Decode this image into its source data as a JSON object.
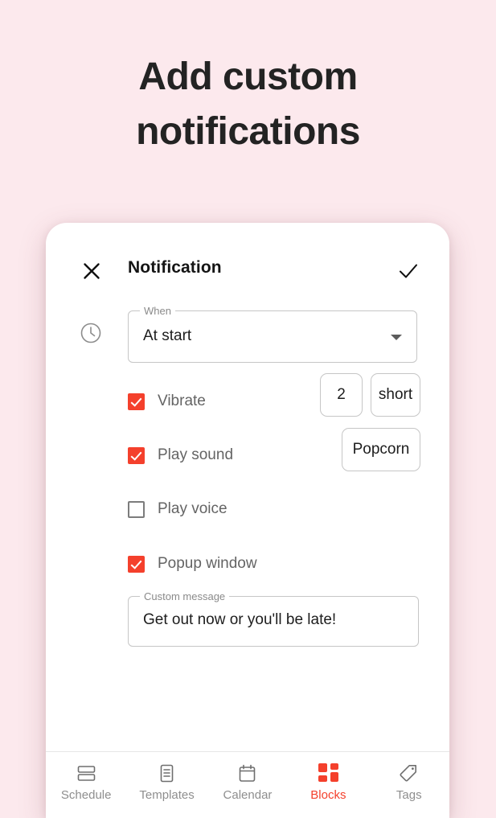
{
  "headline": {
    "line1": "Add custom",
    "line2": "notifications"
  },
  "colors": {
    "background": "#fce9ed",
    "accent": "#f4402c",
    "card": "#ffffff",
    "text_primary": "#1d1d1d",
    "text_secondary": "#646464",
    "border": "#c6c6c6"
  },
  "appbar": {
    "close_icon": "close-x-icon",
    "title": "Notification",
    "done_icon": "checkmark-icon"
  },
  "form": {
    "leading_icon": "clock-icon",
    "when": {
      "label": "When",
      "value": "At start",
      "caret_icon": "chevron-down-icon"
    },
    "options": [
      {
        "name": "vibrate",
        "label": "Vibrate",
        "checked": true,
        "chips": [
          {
            "name": "vibrate-count",
            "value": "2"
          },
          {
            "name": "vibrate-length",
            "value": "short"
          }
        ]
      },
      {
        "name": "play-sound",
        "label": "Play sound",
        "checked": true,
        "chips": [
          {
            "name": "sound-name",
            "value": "Popcorn"
          }
        ]
      },
      {
        "name": "play-voice",
        "label": "Play voice",
        "checked": false,
        "chips": []
      },
      {
        "name": "popup-window",
        "label": "Popup window",
        "checked": true,
        "chips": []
      }
    ],
    "custom_message": {
      "label": "Custom message",
      "value": "Get out now or you'll be late!"
    }
  },
  "bottom_nav": {
    "active_index": 3,
    "items": [
      {
        "label": "Schedule",
        "icon": "stacked-rows-icon"
      },
      {
        "label": "Templates",
        "icon": "document-lines-icon"
      },
      {
        "label": "Calendar",
        "icon": "calendar-icon"
      },
      {
        "label": "Blocks",
        "icon": "blocks-grid-icon"
      },
      {
        "label": "Tags",
        "icon": "tag-icon"
      }
    ]
  }
}
